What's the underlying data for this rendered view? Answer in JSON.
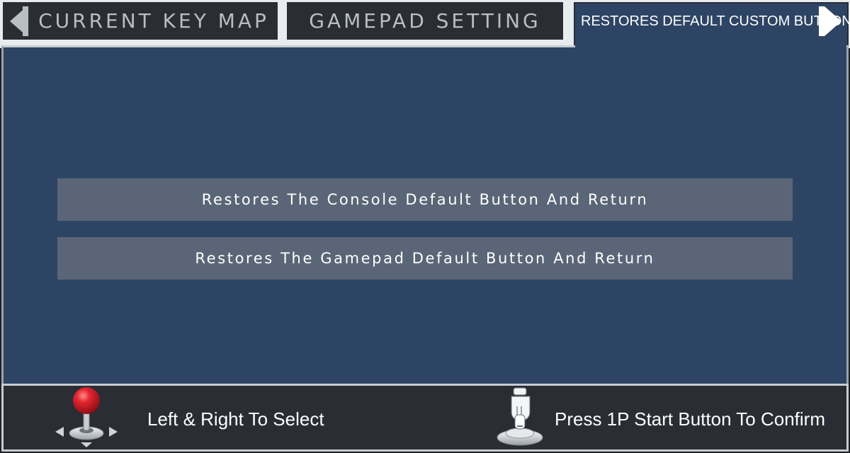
{
  "tabs": {
    "left_tab_label": "CURRENT KEY MAP",
    "middle_tab_label": "GAMEPAD SETTING",
    "active_tab_label": "RESTORES DEFAULT CUSTOM BUTTON",
    "left_arrow_icon": "arrow-left-icon",
    "right_arrow_icon": "arrow-right-icon"
  },
  "menu": {
    "options": [
      {
        "label": "Restores The Console Default Button And Return"
      },
      {
        "label": "Restores The Gamepad Default Button And Return"
      }
    ]
  },
  "hints": {
    "select_icon": "joystick-icon",
    "select_text": "Left & Right To Select",
    "confirm_icon": "press-start-button-icon",
    "confirm_text": "Press 1P Start Button To Confirm"
  },
  "colors": {
    "panel_background": "#2d4464",
    "option_background": "#5a6677",
    "tab_background": "#2a2d34",
    "tab_text": "#b9bec4",
    "joystick_ball": "#d8202a"
  }
}
